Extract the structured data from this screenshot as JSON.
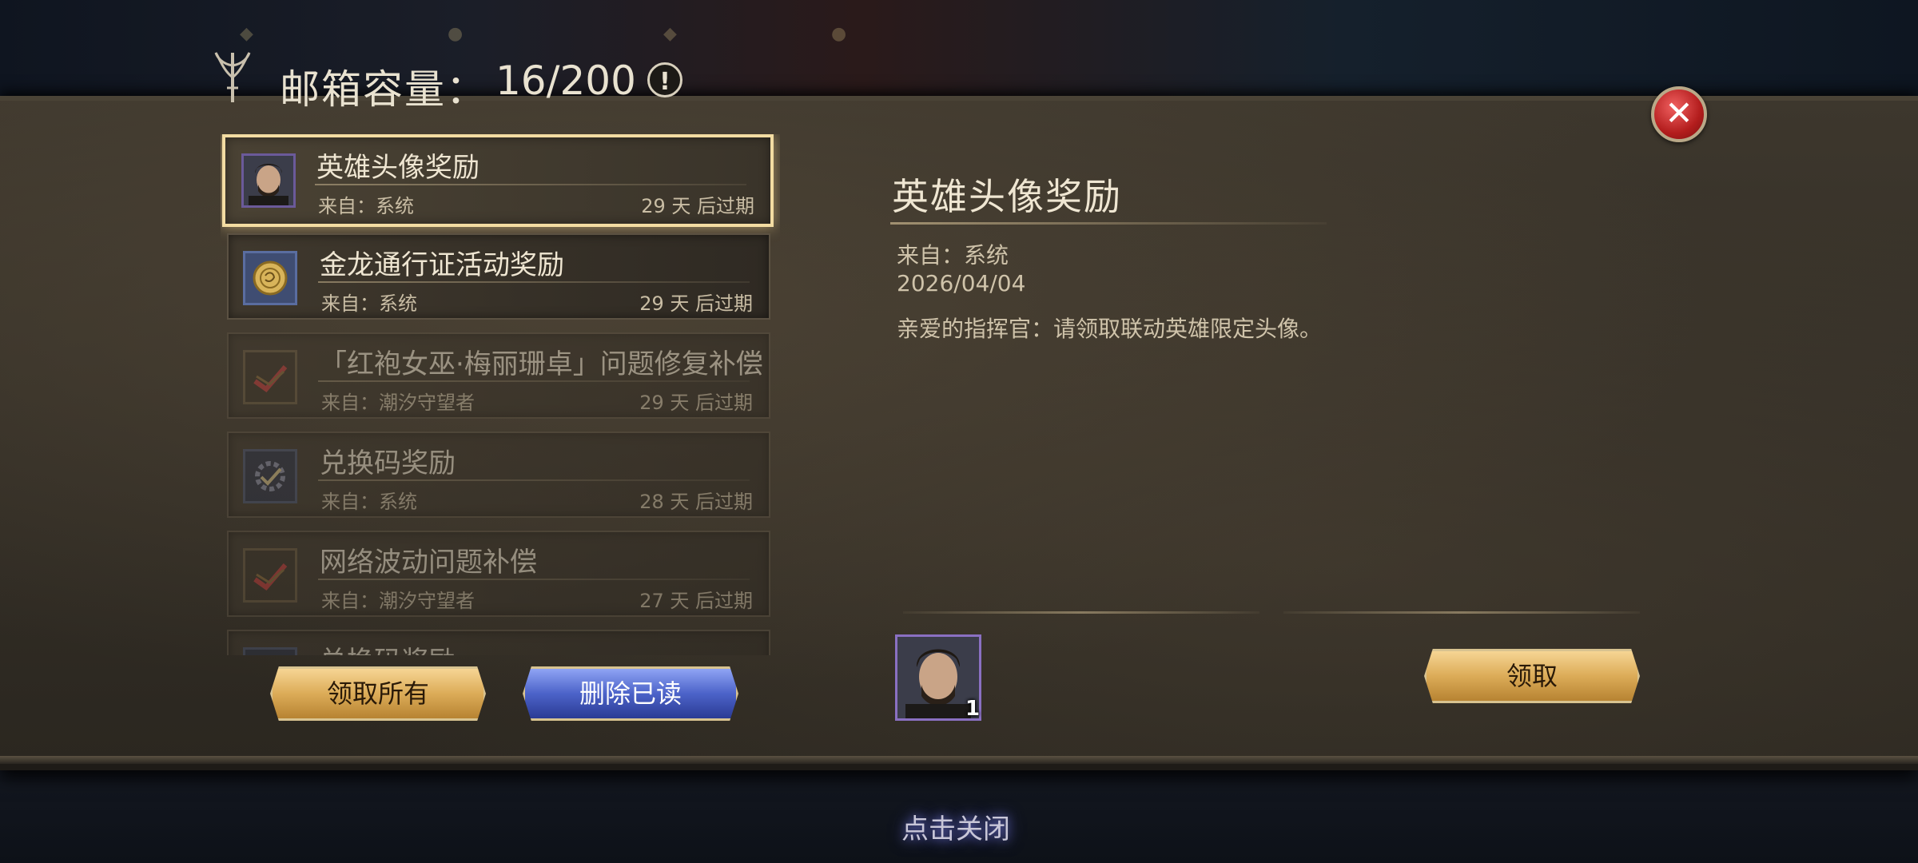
{
  "header": {
    "title": "邮箱容量：",
    "count": "16/200",
    "info_icon": "!",
    "close_icon": "✕"
  },
  "mails": [
    {
      "title": "英雄头像奖励",
      "sender": "来自：系统",
      "expiry": "29 天 后过期",
      "icon": "hero-portrait-icon",
      "selected": true,
      "read": false
    },
    {
      "title": "金龙通行证活动奖励",
      "sender": "来自：系统",
      "expiry": "29 天 后过期",
      "icon": "gold-coin-icon",
      "selected": false,
      "read": false
    },
    {
      "title": "「红袍女巫·梅丽珊卓」问题修复补偿",
      "sender": "来自：潮汐守望者",
      "expiry": "29 天 后过期",
      "icon": "checked-scroll-icon",
      "selected": false,
      "read": true
    },
    {
      "title": "兑换码奖励",
      "sender": "来自：系统",
      "expiry": "28 天 后过期",
      "icon": "checked-gear-icon",
      "selected": false,
      "read": true
    },
    {
      "title": "网络波动问题补偿",
      "sender": "来自：潮汐守望者",
      "expiry": "27 天 后过期",
      "icon": "checked-scroll-icon",
      "selected": false,
      "read": true
    },
    {
      "title": "兑换码奖励",
      "sender": "",
      "expiry": "",
      "icon": "checked-gear-icon",
      "selected": false,
      "read": true
    }
  ],
  "list_actions": {
    "claim_all": "领取所有",
    "delete_read": "删除已读"
  },
  "detail": {
    "title": "英雄头像奖励",
    "sender": "来自：系统",
    "date": "2026/04/04",
    "body": "亲爱的指挥官：请领取联动英雄限定头像。",
    "reward_count": "1",
    "claim_button": "领取"
  },
  "footer": {
    "close_hint": "点击关闭"
  },
  "colors": {
    "gold_button": "#dcac58",
    "blue_button": "#4c63c9",
    "close_red": "#b31d1d",
    "selected_border": "#f3dca2"
  }
}
